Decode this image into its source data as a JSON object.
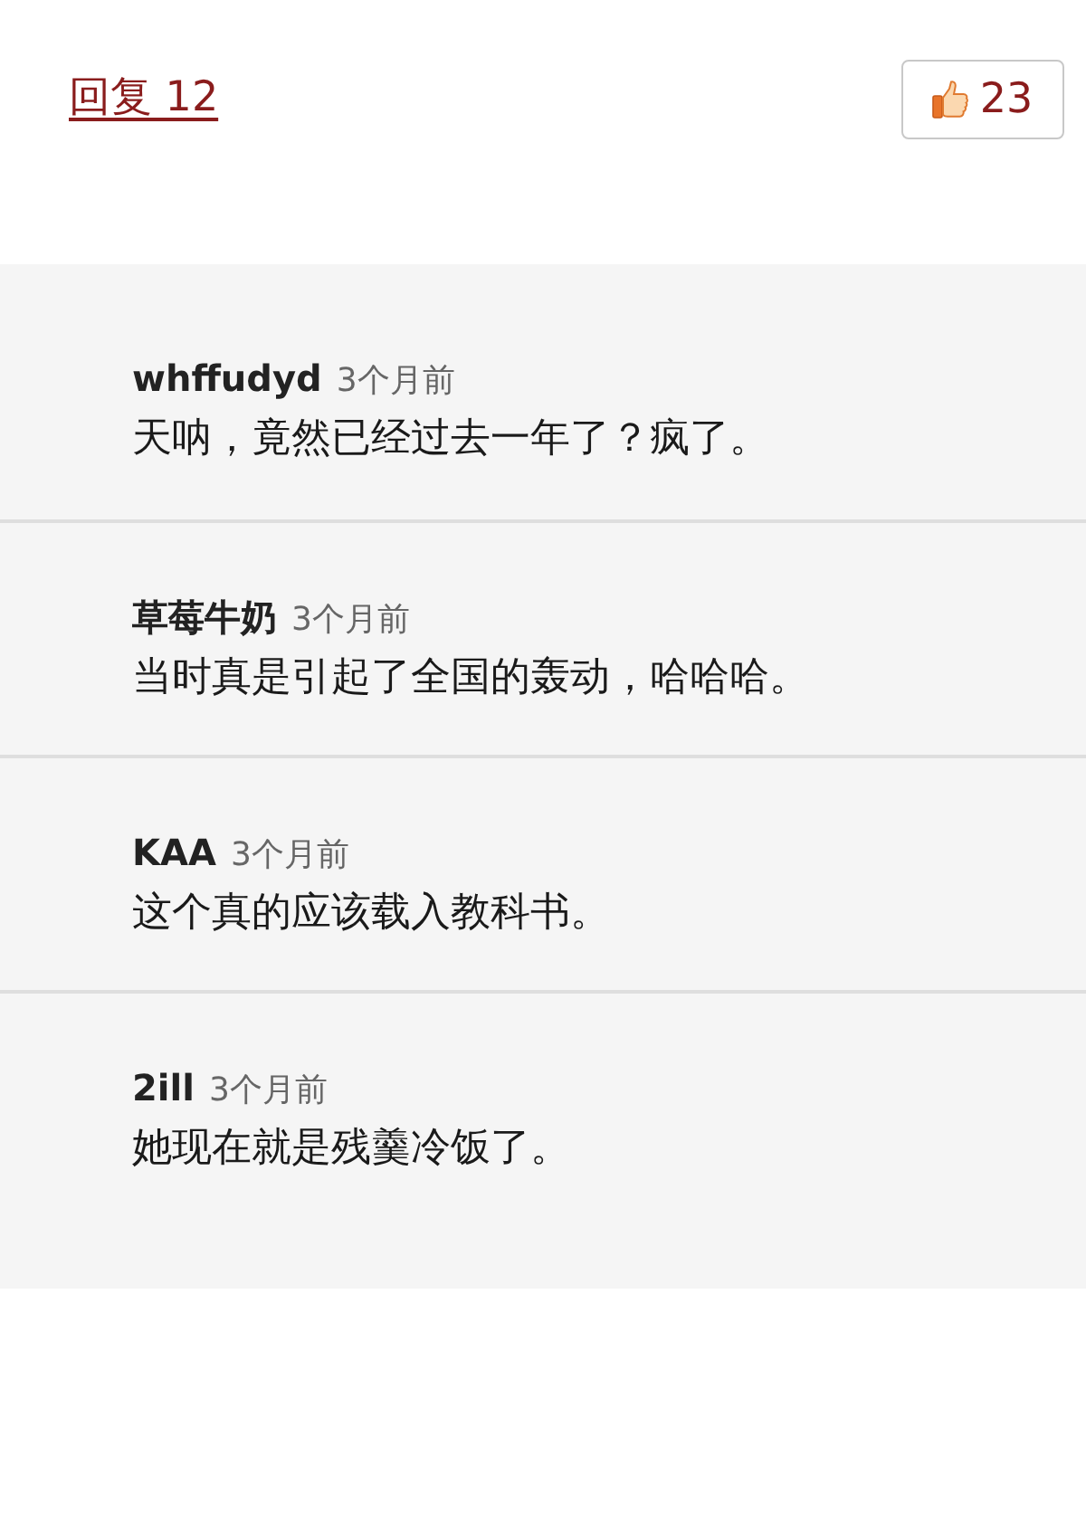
{
  "header": {
    "reply_link": "回复 12",
    "like_button": {
      "count": "23"
    }
  },
  "comments": [
    {
      "user": "whffudyd",
      "time": "3个月前",
      "text": "天呐，竟然已经过去一年了？疯了。"
    },
    {
      "user": "草莓牛奶",
      "time": "3个月前",
      "text": "当时真是引起了全国的轰动，哈哈哈。"
    },
    {
      "user": "KAA",
      "time": "3个月前",
      "text": "这个真的应该载入教科书。"
    },
    {
      "user": "2ill",
      "time": "3个月前",
      "text": "她现在就是残羹冷饭了。"
    }
  ]
}
